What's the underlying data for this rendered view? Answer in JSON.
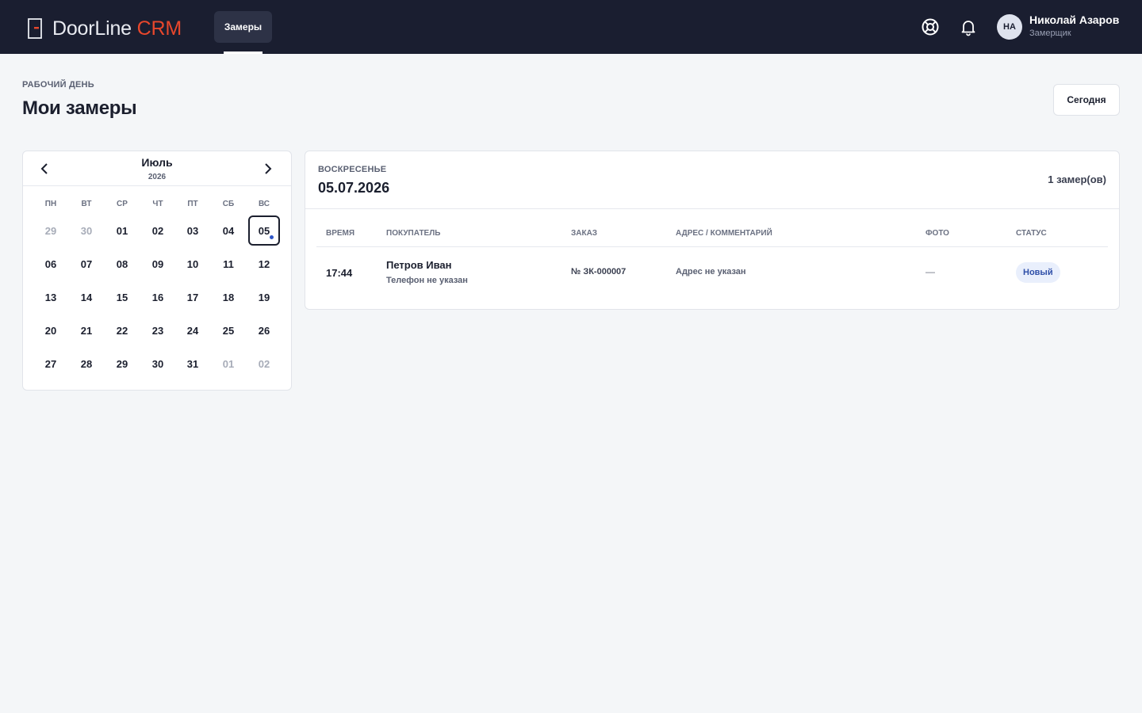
{
  "app": {
    "brand_main": "DoorLine",
    "brand_accent": "CRM",
    "accent_color": "#e8472c"
  },
  "nav": {
    "tabs": [
      {
        "label": "Замеры",
        "active": true
      }
    ]
  },
  "header_icons": [
    "help-lifebuoy-icon",
    "bell-icon"
  ],
  "user": {
    "initials": "НА",
    "name": "Николай Азаров",
    "role": "Замерщик"
  },
  "page": {
    "eyebrow": "РАБОЧИЙ ДЕНЬ",
    "title": "Мои замеры",
    "today_button": "Сегодня"
  },
  "calendar": {
    "month": "Июль",
    "year": "2026",
    "weekdays": [
      "ПН",
      "ВТ",
      "СР",
      "ЧТ",
      "ПТ",
      "СБ",
      "ВС"
    ],
    "weeks": [
      [
        {
          "d": "29",
          "muted": true
        },
        {
          "d": "30",
          "muted": true
        },
        {
          "d": "01"
        },
        {
          "d": "02"
        },
        {
          "d": "03"
        },
        {
          "d": "04"
        },
        {
          "d": "05",
          "selected": true,
          "has_event": true
        }
      ],
      [
        {
          "d": "06"
        },
        {
          "d": "07"
        },
        {
          "d": "08"
        },
        {
          "d": "09"
        },
        {
          "d": "10"
        },
        {
          "d": "11"
        },
        {
          "d": "12"
        }
      ],
      [
        {
          "d": "13"
        },
        {
          "d": "14"
        },
        {
          "d": "15"
        },
        {
          "d": "16"
        },
        {
          "d": "17"
        },
        {
          "d": "18"
        },
        {
          "d": "19"
        }
      ],
      [
        {
          "d": "20"
        },
        {
          "d": "21"
        },
        {
          "d": "22"
        },
        {
          "d": "23"
        },
        {
          "d": "24"
        },
        {
          "d": "25"
        },
        {
          "d": "26"
        }
      ],
      [
        {
          "d": "27"
        },
        {
          "d": "28"
        },
        {
          "d": "29"
        },
        {
          "d": "30"
        },
        {
          "d": "31"
        },
        {
          "d": "01",
          "muted": true
        },
        {
          "d": "02",
          "muted": true
        }
      ]
    ]
  },
  "schedule": {
    "weekday": "ВОСКРЕСЕНЬЕ",
    "date": "05.07.2026",
    "count": "1 замер(ов)",
    "columns": {
      "time": "ВРЕМЯ",
      "customer": "ПОКУПАТЕЛЬ",
      "order": "ЗАКАЗ",
      "address": "АДРЕС / КОММЕНТАРИЙ",
      "photo": "ФОТО",
      "status": "СТАТУС"
    },
    "rows": [
      {
        "time": "17:44",
        "customer": "Петров Иван",
        "phone": "Телефон не указан",
        "order": "№ ЗК-000007",
        "address": "Адрес не указан",
        "photo": "—",
        "status": "Новый"
      }
    ]
  }
}
